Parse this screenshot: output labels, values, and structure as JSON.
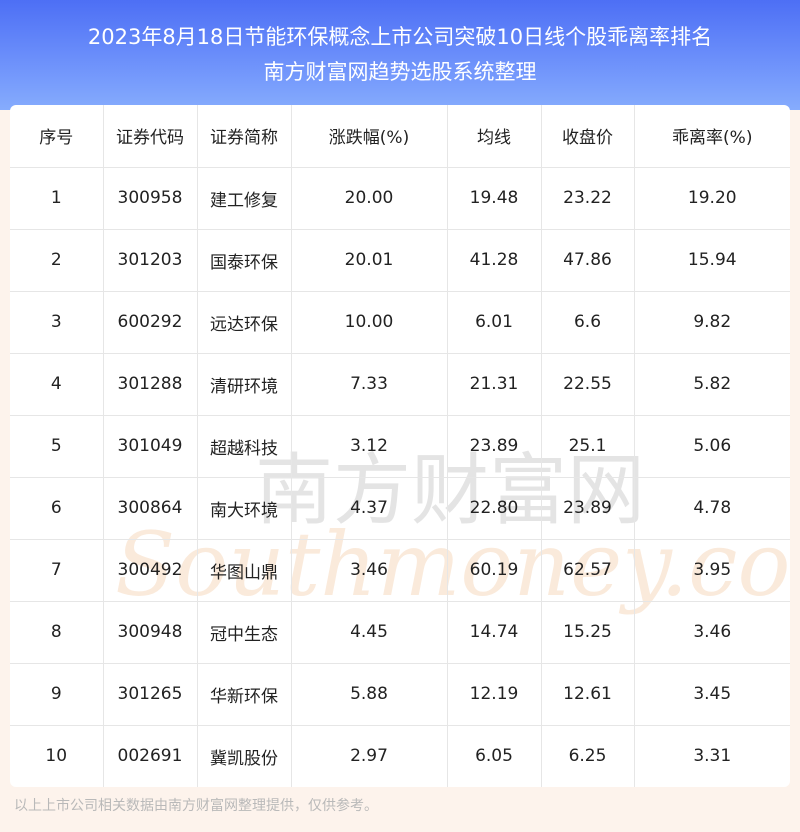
{
  "header": {
    "title_line1": "2023年8月18日节能环保概念上市公司突破10日线个股乖离率排名",
    "title_line2": "南方财富网趋势选股系统整理"
  },
  "table": {
    "columns": [
      "序号",
      "证券代码",
      "证券简称",
      "涨跌幅(%)",
      "均线",
      "收盘价",
      "乖离率(%)"
    ],
    "rows": [
      [
        "1",
        "300958",
        "建工修复",
        "20.00",
        "19.48",
        "23.22",
        "19.20"
      ],
      [
        "2",
        "301203",
        "国泰环保",
        "20.01",
        "41.28",
        "47.86",
        "15.94"
      ],
      [
        "3",
        "600292",
        "远达环保",
        "10.00",
        "6.01",
        "6.6",
        "9.82"
      ],
      [
        "4",
        "301288",
        "清研环境",
        "7.33",
        "21.31",
        "22.55",
        "5.82"
      ],
      [
        "5",
        "301049",
        "超越科技",
        "3.12",
        "23.89",
        "25.1",
        "5.06"
      ],
      [
        "6",
        "300864",
        "南大环境",
        "4.37",
        "22.80",
        "23.89",
        "4.78"
      ],
      [
        "7",
        "300492",
        "华图山鼎",
        "3.46",
        "60.19",
        "62.57",
        "3.95"
      ],
      [
        "8",
        "300948",
        "冠中生态",
        "4.45",
        "14.74",
        "15.25",
        "3.46"
      ],
      [
        "9",
        "301265",
        "华新环保",
        "5.88",
        "12.19",
        "12.61",
        "3.45"
      ],
      [
        "10",
        "002691",
        "冀凯股份",
        "2.97",
        "6.05",
        "6.25",
        "3.31"
      ]
    ]
  },
  "watermark": {
    "chinese": "南方财富网",
    "latin": "Southmoney.com"
  },
  "footer": {
    "text": "以上上市公司相关数据由南方财富网整理提供，仅供参考。"
  }
}
